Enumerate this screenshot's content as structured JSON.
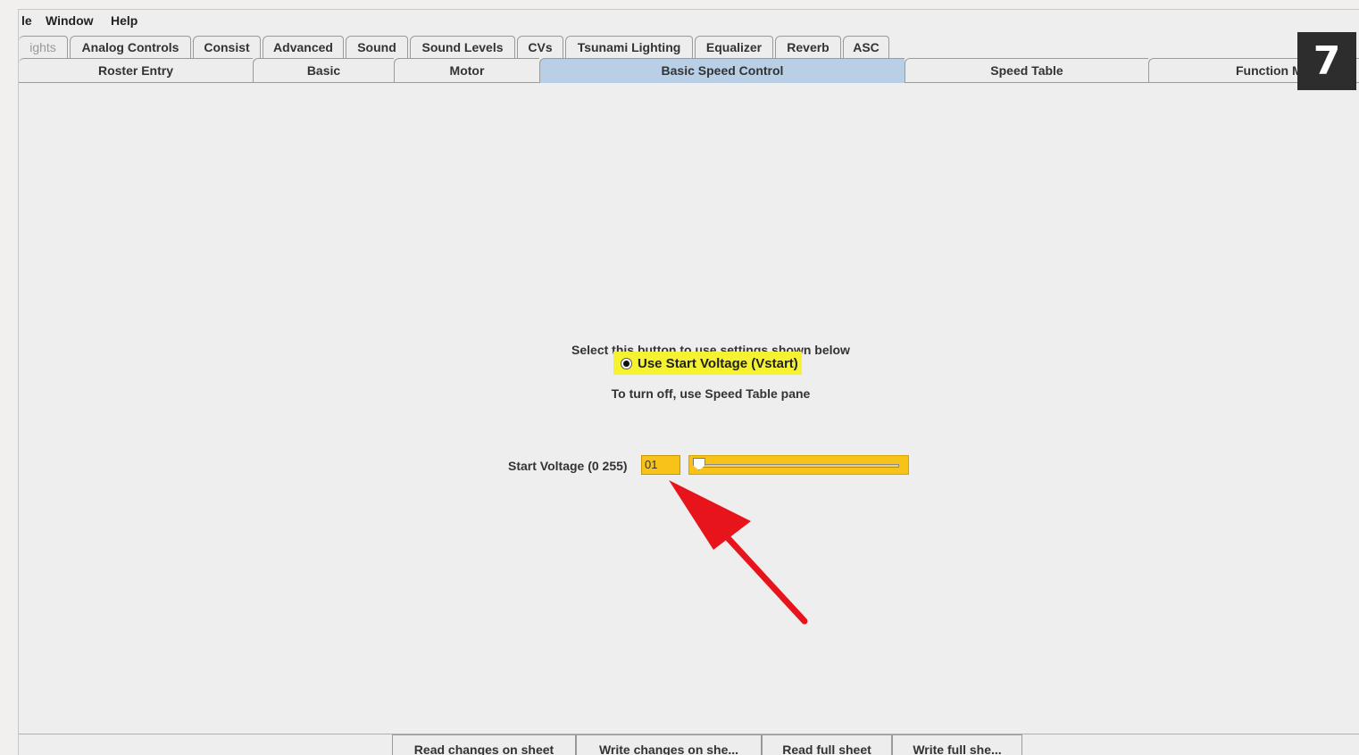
{
  "menubar": {
    "items": [
      "le",
      "Window",
      "Help"
    ]
  },
  "tabs_row1": [
    "ights",
    "Analog Controls",
    "Consist",
    "Advanced",
    "Sound",
    "Sound Levels",
    "CVs",
    "Tsunami Lighting",
    "Equalizer",
    "Reverb",
    "ASC"
  ],
  "tabs_row2": [
    "Roster Entry",
    "Basic",
    "Motor",
    "Basic Speed Control",
    "Speed Table",
    "Function M"
  ],
  "selected_tab": "Basic Speed Control",
  "badge": "7",
  "panel": {
    "hint_select": "Select this button to use settings shown below",
    "radio_label": "Use Start Voltage (Vstart)",
    "radio_checked": true,
    "hint_turn_off": "To turn off, use Speed Table pane",
    "start_voltage_label": "Start Voltage (0 255)",
    "start_voltage_value": "01",
    "slider_value": 1,
    "slider_max": 255
  },
  "buttons": [
    "Read changes on sheet",
    "Write changes on she...",
    "Read full sheet",
    "Write full she..."
  ],
  "colors": {
    "highlight_yellow": "#f5f232",
    "field_orange": "#f7c21a",
    "selected_tab": "#b8cfe5",
    "arrow_red": "#e8141c"
  },
  "icons": {
    "badge": "number-badge",
    "annotation": "red-arrow-icon"
  }
}
